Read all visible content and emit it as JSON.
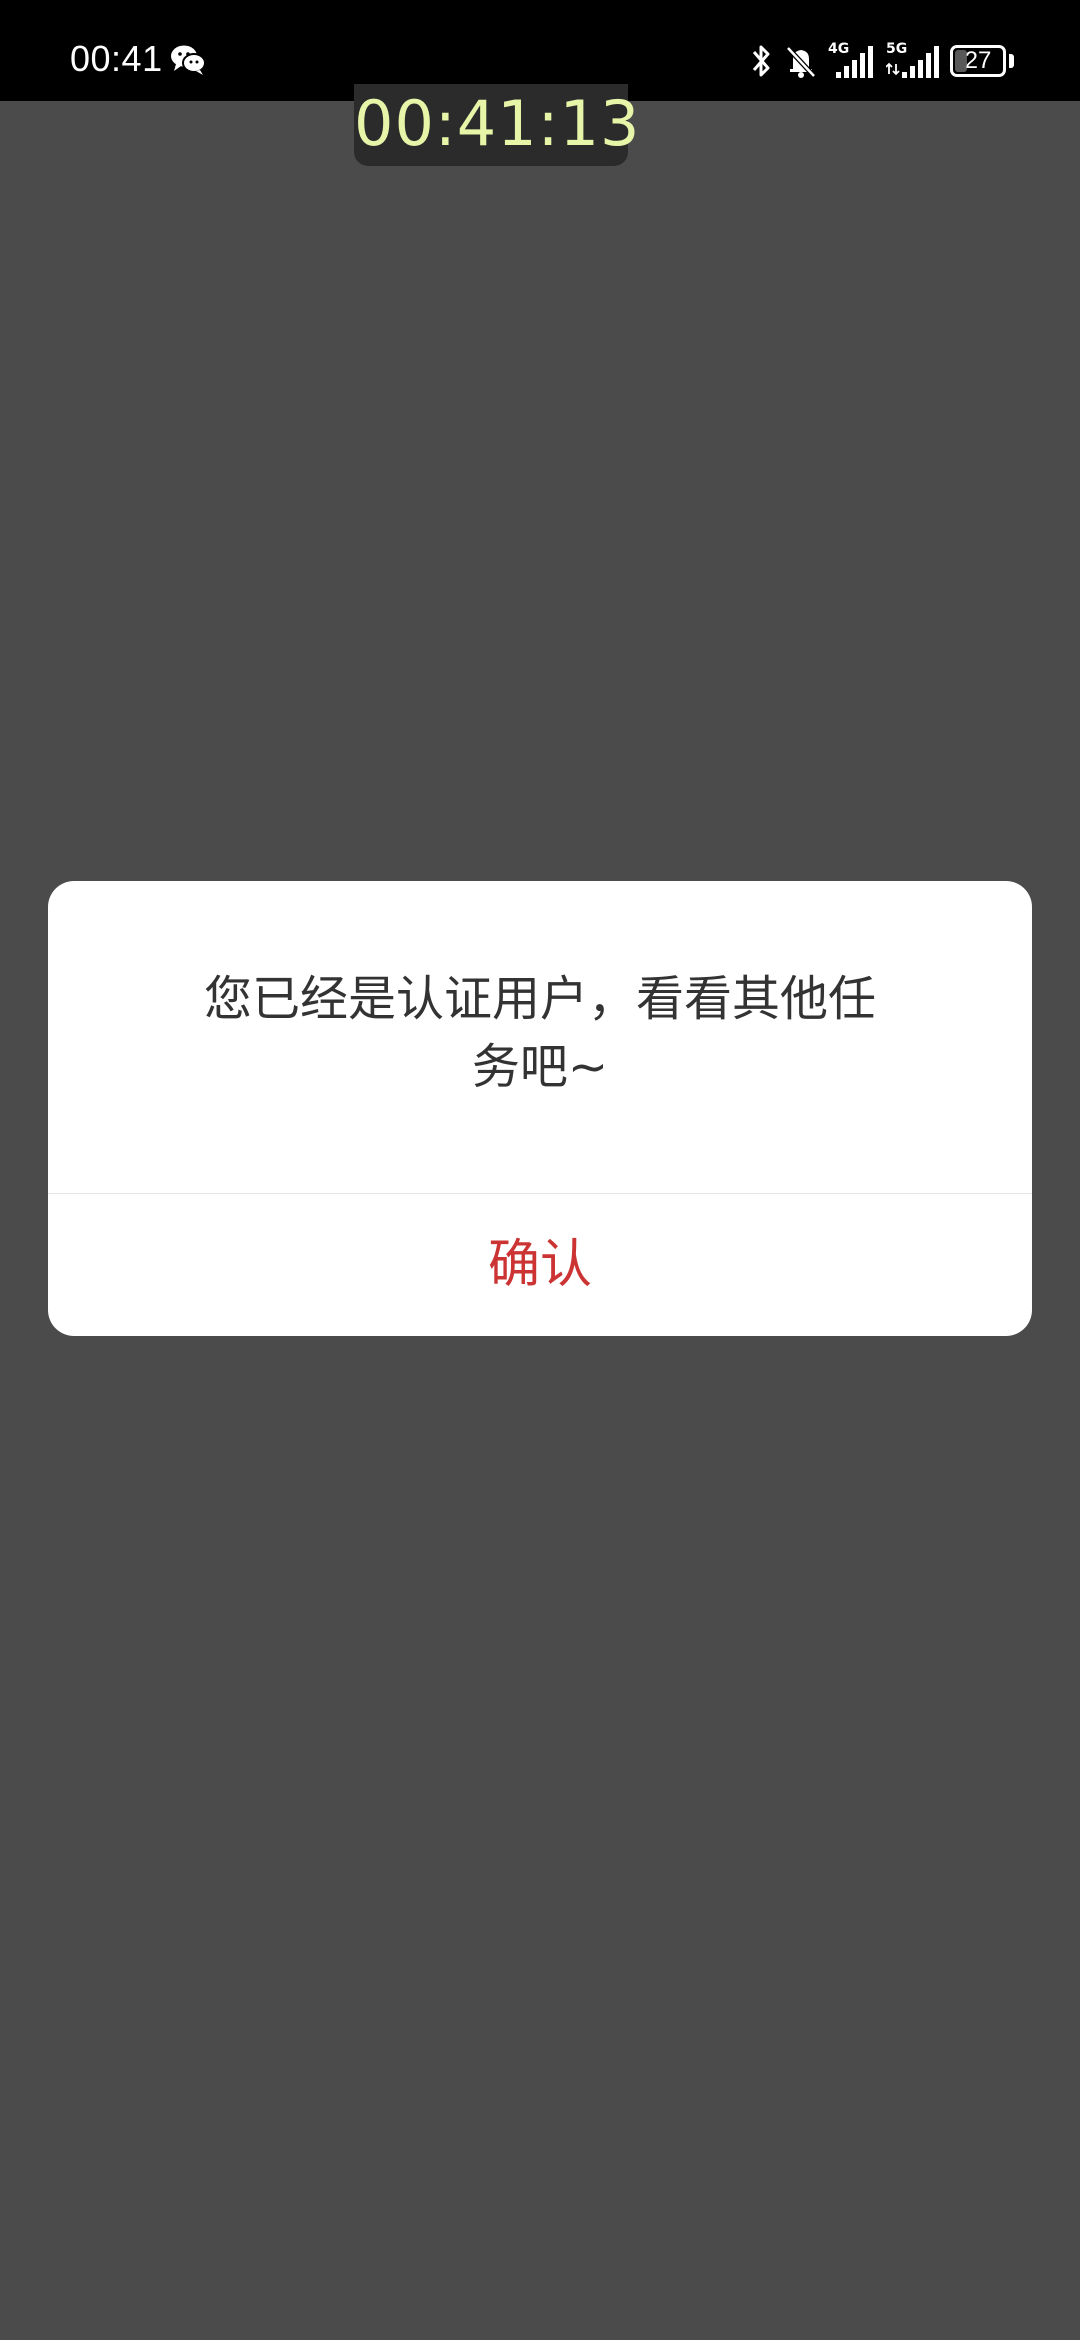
{
  "status_bar": {
    "time": "00:41",
    "network_1": "4G",
    "network_2": "5G",
    "battery_level": "27",
    "battery_fraction": 0.27,
    "icons": [
      "wechat-icon",
      "bluetooth-icon",
      "notifications-off-icon",
      "signal-4g-icon",
      "signal-5g-icon",
      "battery-icon"
    ]
  },
  "timer_overlay": {
    "text": "00:41:13",
    "color": "#e6f5a8"
  },
  "dialog": {
    "message": "您已经是认证用户，看看其他任务吧~",
    "confirm_label": "确认",
    "confirm_color": "#cc3333"
  },
  "colors": {
    "background": "#4b4b4b",
    "status_bar": "#000000",
    "dialog": "#ffffff"
  }
}
